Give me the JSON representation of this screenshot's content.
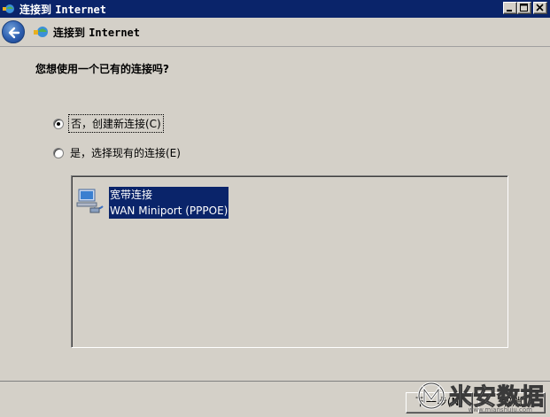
{
  "window": {
    "title_cn": "连接到",
    "title_en": "Internet"
  },
  "header": {
    "title_cn": "连接到",
    "title_en": "Internet"
  },
  "main": {
    "question": "您想使用一个已有的连接吗?",
    "options": [
      {
        "label": "否，创建新连接(C)",
        "checked": true,
        "focused": true
      },
      {
        "label": "是，选择现有的连接(E)",
        "checked": false,
        "focused": false
      }
    ],
    "connections": [
      {
        "name": "宽带连接",
        "device": "WAN Miniport (PPPOE)",
        "selected": true,
        "icon": "network-computer-icon"
      }
    ]
  },
  "footer": {
    "next_label": "下一步(N)",
    "cancel_label": "取消"
  },
  "watermark": {
    "text": "米安数据",
    "url": "www.mianshuju.com"
  },
  "colors": {
    "titlebar": "#0a246a",
    "face": "#d4d0c8",
    "selection": "#0a246a"
  }
}
